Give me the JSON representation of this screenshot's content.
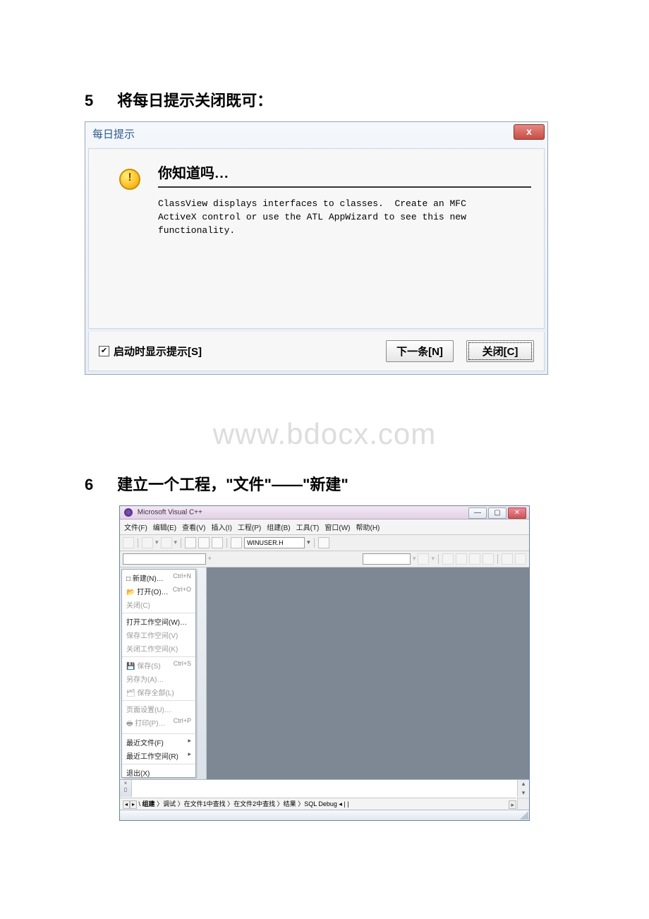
{
  "step5": {
    "num": "5",
    "text": "将每日提示关闭既可："
  },
  "tipDialog": {
    "title": "每日提示",
    "closeX": "x",
    "heading": "你知道吗…",
    "body": "ClassView displays interfaces to classes.  Create an MFC\nActiveX control or use the ATL AppWizard to see this new\nfunctionality.",
    "showOnStart": "启动时显示提示[S]",
    "nextBtn": "下一条[N]",
    "closeBtn": "关闭[C]"
  },
  "watermark": "www.bdocx.com",
  "step6": {
    "num": "6",
    "text": "建立一个工程，\"文件\"——\"新建\""
  },
  "vc": {
    "title": "Microsoft Visual C++",
    "menuBar": [
      "文件(F)",
      "编辑(E)",
      "查看(V)",
      "插入(I)",
      "工程(P)",
      "组建(B)",
      "工具(T)",
      "窗口(W)",
      "帮助(H)"
    ],
    "winuser": "WINUSER.H",
    "fileMenu": {
      "g1": [
        {
          "t": "新建(N)…",
          "s": "Ctrl+N",
          "dim": false,
          "icon": "□"
        },
        {
          "t": "打开(O)…",
          "s": "Ctrl+O",
          "dim": false,
          "icon": "📂"
        },
        {
          "t": "关闭(C)",
          "s": "",
          "dim": true,
          "icon": ""
        }
      ],
      "g2": [
        {
          "t": "打开工作空间(W)…",
          "s": "",
          "dim": false
        },
        {
          "t": "保存工作空间(V)",
          "s": "",
          "dim": true
        },
        {
          "t": "关闭工作空间(K)",
          "s": "",
          "dim": true
        }
      ],
      "g3": [
        {
          "t": "保存(S)",
          "s": "Ctrl+S",
          "dim": true,
          "icon": "💾"
        },
        {
          "t": "另存为(A)…",
          "s": "",
          "dim": true
        },
        {
          "t": "保存全部(L)",
          "s": "",
          "dim": true,
          "icon": "🗂"
        }
      ],
      "g4": [
        {
          "t": "页面设置(U)…",
          "s": "",
          "dim": true
        },
        {
          "t": "打印(P)…",
          "s": "Ctrl+P",
          "dim": true,
          "icon": "🖶"
        }
      ],
      "g5": [
        {
          "t": "最近文件(F)",
          "s": "",
          "dim": false,
          "arrow": true
        },
        {
          "t": "最近工作空间(R)",
          "s": "",
          "dim": false,
          "arrow": true
        }
      ],
      "g6": [
        {
          "t": "退出(X)",
          "s": "",
          "dim": false
        }
      ]
    },
    "tabs": {
      "nav": [
        "◂",
        "▸"
      ],
      "items": [
        "组建",
        "调试",
        "在文件1中查找",
        "在文件2中查找",
        "结果",
        "SQL Debug"
      ],
      "tail": "◂ | |"
    }
  }
}
